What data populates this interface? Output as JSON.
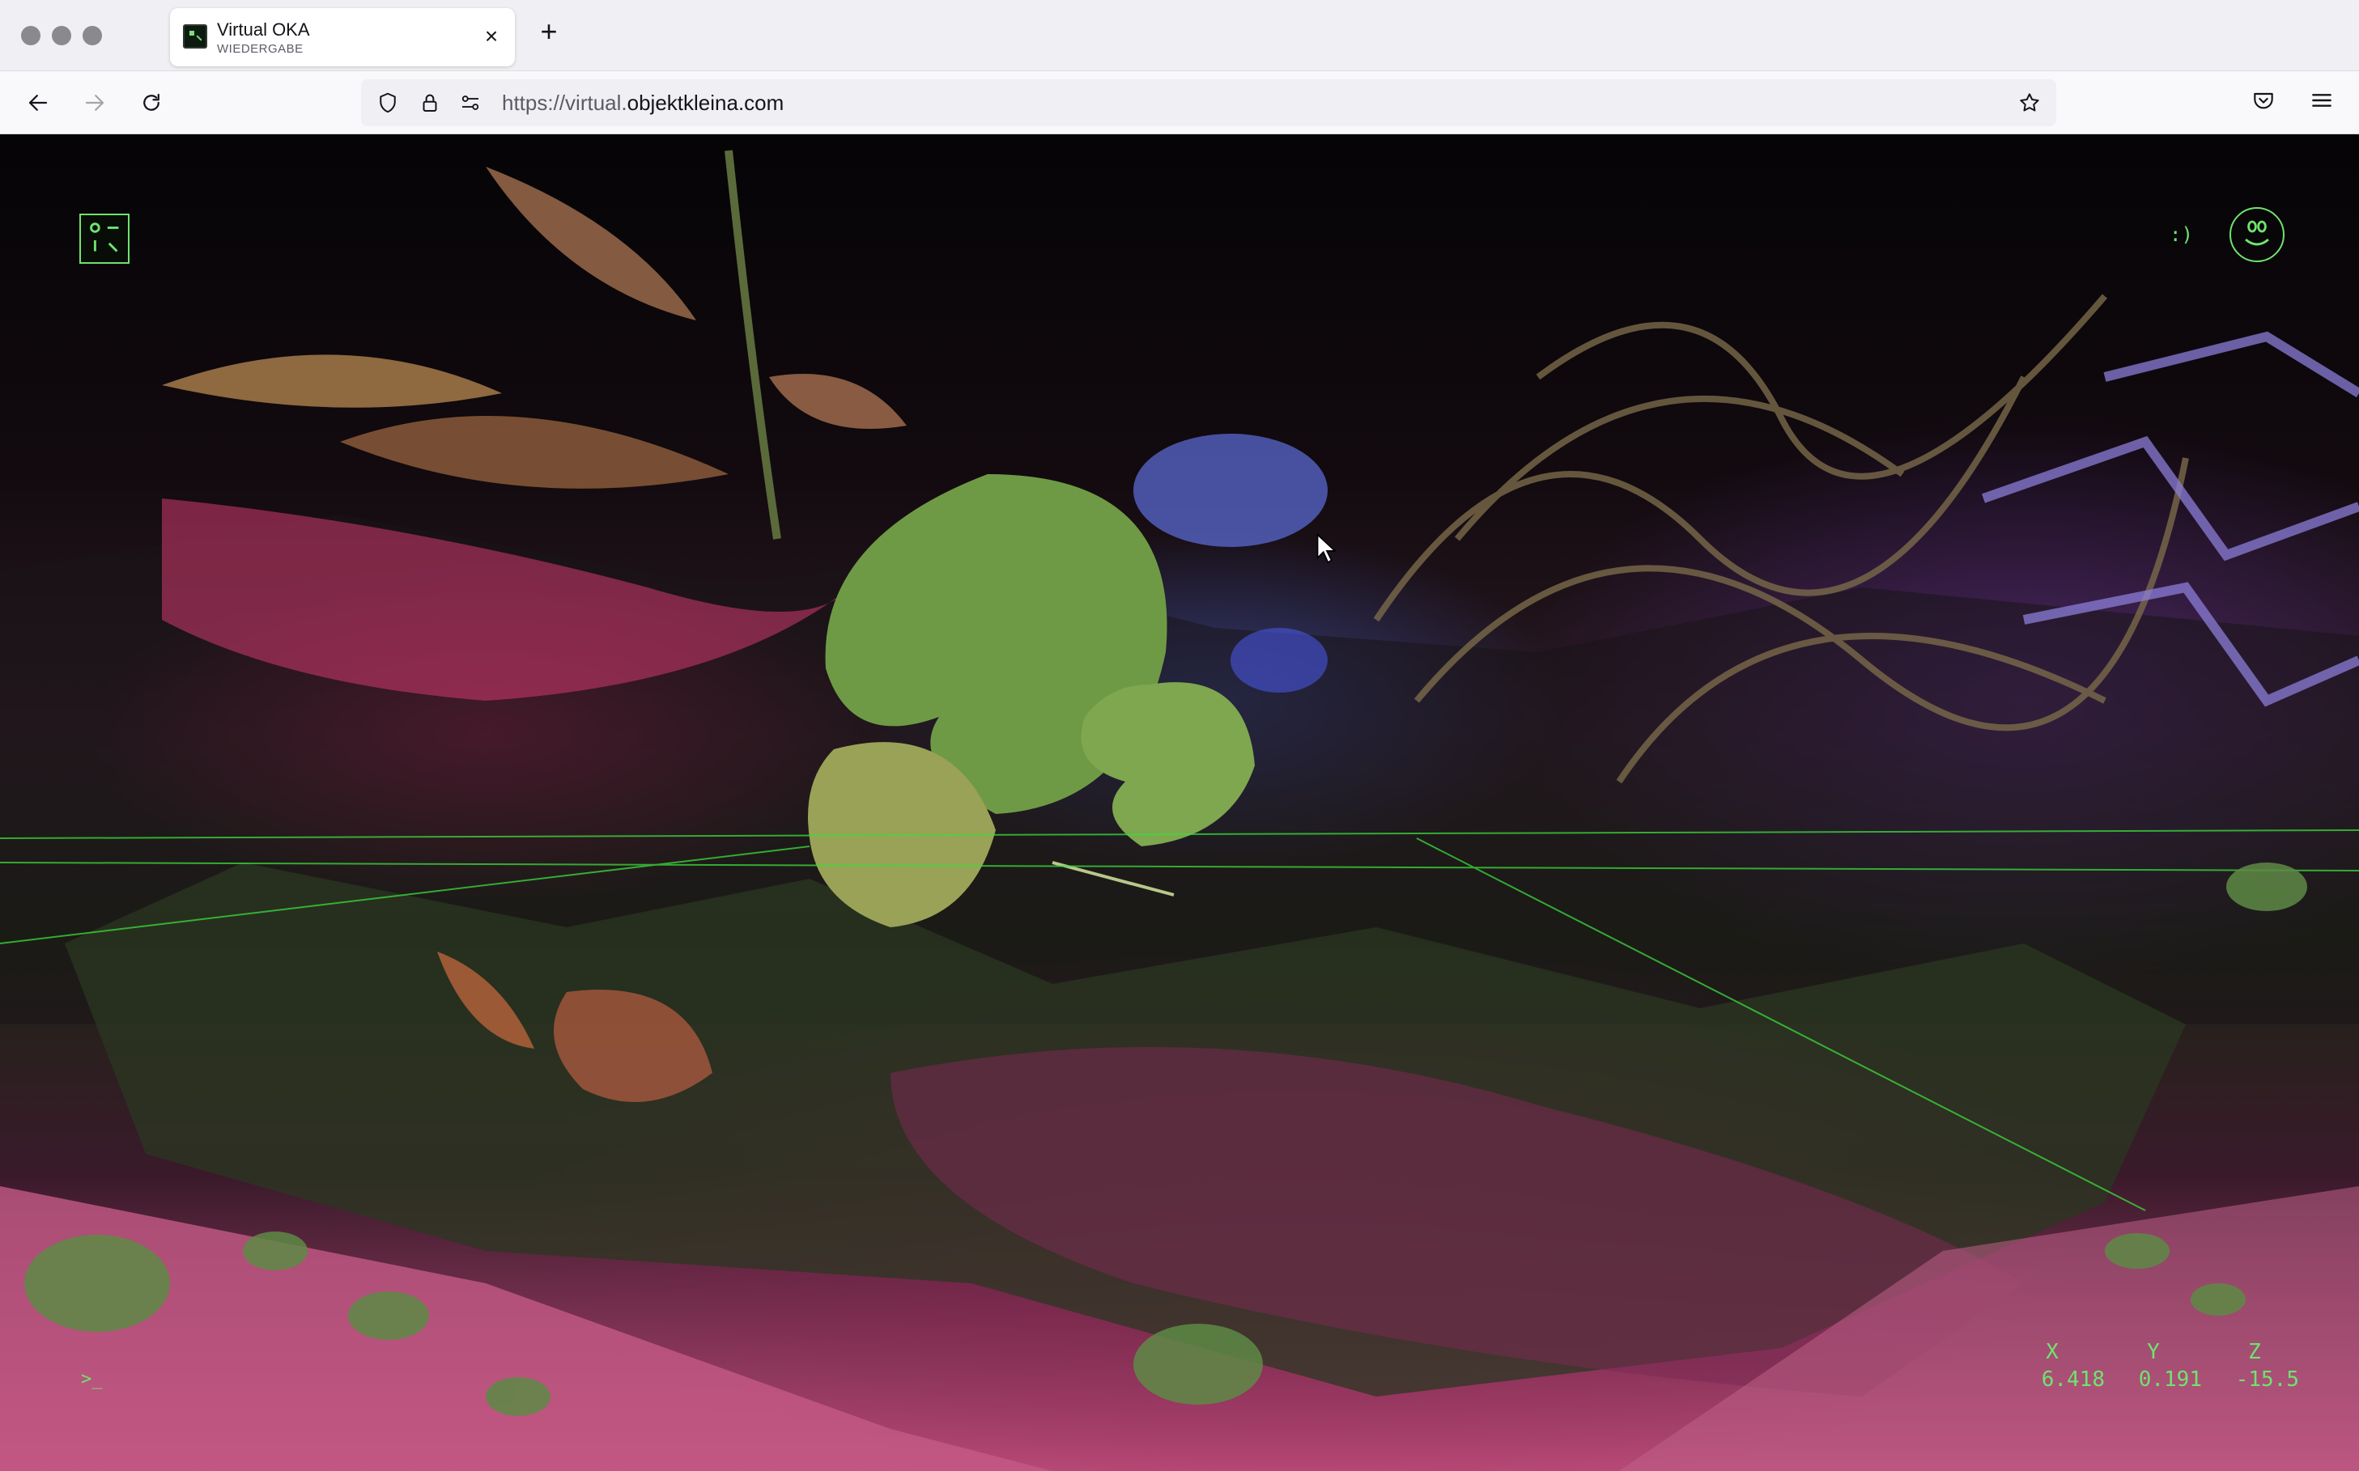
{
  "browser": {
    "tab": {
      "title": "Virtual OKA",
      "subtitle": "WIEDERGABE",
      "close_icon": "close-icon",
      "favicon": "oka-favicon-icon"
    },
    "new_tab_label": "+",
    "url": {
      "prefix": "https://virtual.",
      "domain": "objektkleina.com"
    }
  },
  "hud": {
    "smile_text": ":)",
    "prompt": ">_",
    "coords": {
      "labels": [
        "X",
        "Y",
        "Z"
      ],
      "values": [
        "6.418",
        "0.191",
        "-15.5"
      ]
    }
  },
  "colors": {
    "hud_green": "#6fe36f",
    "chrome_bg": "#f0f0f4",
    "toolbar_bg": "#f9f9fb"
  }
}
